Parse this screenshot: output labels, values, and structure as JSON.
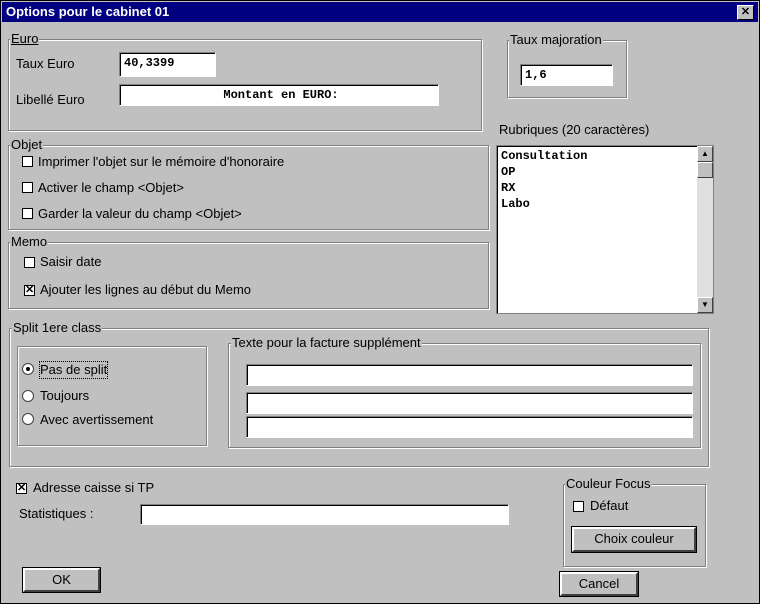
{
  "window": {
    "title": "Options pour le cabinet 01",
    "close_glyph": "✕"
  },
  "euro": {
    "legend": "Euro",
    "taux_label": "Taux Euro",
    "taux_value": "40,3399",
    "libelle_label": "Libellé Euro",
    "libelle_value": "Montant en EURO:"
  },
  "taux_majoration": {
    "legend": "Taux majoration",
    "value": "1,6"
  },
  "objet": {
    "legend": "Objet",
    "options": [
      {
        "label": "Imprimer l'objet sur le mémoire d'honoraire",
        "checked": false
      },
      {
        "label": "Activer le champ <Objet>",
        "checked": false
      },
      {
        "label": "Garder la valeur du champ <Objet>",
        "checked": false
      }
    ]
  },
  "memo": {
    "legend": "Memo",
    "options": [
      {
        "label": "Saisir date",
        "checked": false
      },
      {
        "label": "Ajouter les lignes au début du Memo",
        "checked": true
      }
    ]
  },
  "rubriques": {
    "label": "Rubriques (20 caractères)",
    "items": [
      "Consultation",
      "OP",
      "RX",
      "Labo"
    ]
  },
  "split": {
    "legend": "Split 1ere class",
    "options": [
      {
        "label": "Pas de split",
        "selected": true
      },
      {
        "label": "Toujours",
        "selected": false
      },
      {
        "label": "Avec avertissement",
        "selected": false
      }
    ]
  },
  "texte_facture": {
    "legend": "Texte pour la facture supplément",
    "lines": [
      "",
      "",
      ""
    ]
  },
  "adresse_caisse": {
    "label": "Adresse caisse si TP",
    "checked": true
  },
  "statistiques": {
    "label": "Statistiques :",
    "value": ""
  },
  "couleur_focus": {
    "legend": "Couleur Focus",
    "defaut_label": "Défaut",
    "defaut_checked": false,
    "choix_button": "Choix couleur"
  },
  "buttons": {
    "ok": "OK",
    "cancel": "Cancel"
  },
  "glyphs": {
    "check": "✕",
    "arrow_up": "▲",
    "arrow_down": "▼"
  }
}
